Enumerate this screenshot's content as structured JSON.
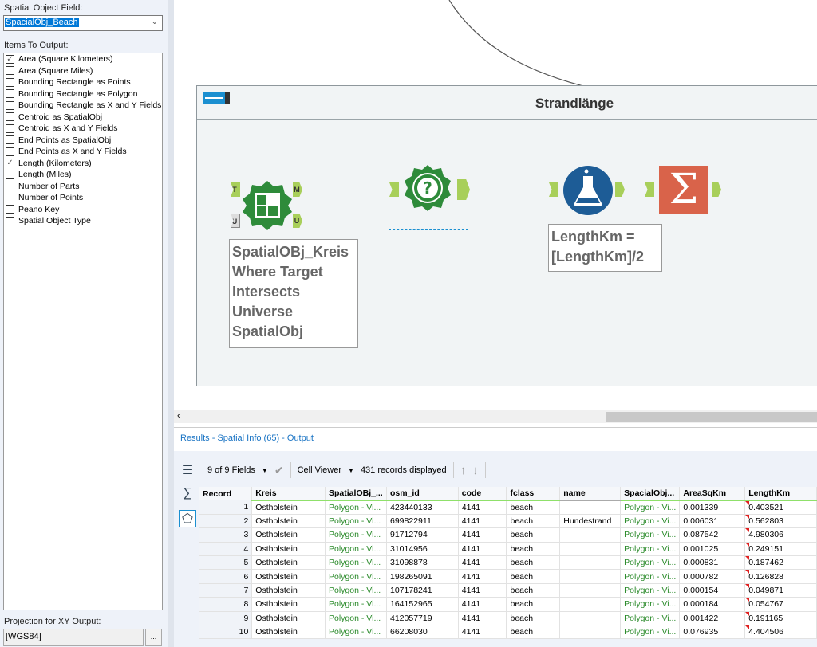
{
  "config": {
    "spatial_field_label": "Spatial Object Field:",
    "spatial_field_value": "SpacialObj_Beach",
    "items_label": "Items To Output:",
    "items": [
      {
        "label": "Area (Square Kilometers)",
        "checked": true
      },
      {
        "label": "Area (Square Miles)",
        "checked": false
      },
      {
        "label": "Bounding Rectangle as Points",
        "checked": false
      },
      {
        "label": "Bounding Rectangle as Polygon",
        "checked": false
      },
      {
        "label": "Bounding Rectangle as X and Y Fields",
        "checked": false
      },
      {
        "label": "Centroid as SpatialObj",
        "checked": false
      },
      {
        "label": "Centroid as X and Y Fields",
        "checked": false
      },
      {
        "label": "End Points as SpatialObj",
        "checked": false
      },
      {
        "label": "End Points as X and Y Fields",
        "checked": false
      },
      {
        "label": "Length (Kilometers)",
        "checked": true
      },
      {
        "label": "Length (Miles)",
        "checked": false
      },
      {
        "label": "Number of Parts",
        "checked": false
      },
      {
        "label": "Number of Points",
        "checked": false
      },
      {
        "label": "Peano Key",
        "checked": false
      },
      {
        "label": "Spatial Object Type",
        "checked": false
      }
    ],
    "projection_label": "Projection for XY Output:",
    "projection_value": "[WGS84]",
    "projection_button": "..."
  },
  "canvas": {
    "container_title": "Strandlänge",
    "spatial_match_annotation": "SpatialOBj_Kreis Where Target Intersects Universe SpatialObj",
    "formula_annotation": "LengthKm = [LengthKm]/2",
    "anchors": {
      "t": "T",
      "u": "U",
      "m": "M",
      "u_out": "U"
    }
  },
  "results": {
    "title": "Results - Spatial Info (65) - Output",
    "fields": "9 of 9 Fields",
    "cell_viewer": "Cell Viewer",
    "records": "431 records displayed",
    "columns": [
      "Record",
      "Kreis",
      "SpatialOBj_...",
      "osm_id",
      "code",
      "fclass",
      "name",
      "SpacialObj...",
      "AreaSqKm",
      "LengthKm"
    ],
    "rows": [
      [
        "1",
        "Ostholstein",
        "Polygon - Vi...",
        "423440133",
        "4141",
        "beach",
        "",
        "Polygon - Vi...",
        "0.001339",
        "0.403521"
      ],
      [
        "2",
        "Ostholstein",
        "Polygon - Vi...",
        "699822911",
        "4141",
        "beach",
        "Hundestrand",
        "Polygon - Vi...",
        "0.006031",
        "0.562803"
      ],
      [
        "3",
        "Ostholstein",
        "Polygon - Vi...",
        "91712794",
        "4141",
        "beach",
        "",
        "Polygon - Vi...",
        "0.087542",
        "4.980306"
      ],
      [
        "4",
        "Ostholstein",
        "Polygon - Vi...",
        "31014956",
        "4141",
        "beach",
        "",
        "Polygon - Vi...",
        "0.001025",
        "0.249151"
      ],
      [
        "5",
        "Ostholstein",
        "Polygon - Vi...",
        "31098878",
        "4141",
        "beach",
        "",
        "Polygon - Vi...",
        "0.000831",
        "0.187462"
      ],
      [
        "6",
        "Ostholstein",
        "Polygon - Vi...",
        "198265091",
        "4141",
        "beach",
        "",
        "Polygon - Vi...",
        "0.000782",
        "0.126828"
      ],
      [
        "7",
        "Ostholstein",
        "Polygon - Vi...",
        "107178241",
        "4141",
        "beach",
        "",
        "Polygon - Vi...",
        "0.000154",
        "0.049871"
      ],
      [
        "8",
        "Ostholstein",
        "Polygon - Vi...",
        "164152965",
        "4141",
        "beach",
        "",
        "Polygon - Vi...",
        "0.000184",
        "0.054767"
      ],
      [
        "9",
        "Ostholstein",
        "Polygon - Vi...",
        "412057719",
        "4141",
        "beach",
        "",
        "Polygon - Vi...",
        "0.001422",
        "0.191165"
      ],
      [
        "10",
        "Ostholstein",
        "Polygon - Vi...",
        "66208030",
        "4141",
        "beach",
        "",
        "Polygon - Vi...",
        "0.076935",
        "4.404506"
      ]
    ]
  },
  "colors": {
    "accent": "#0078d7",
    "spatial_tool": "#2e8b3a",
    "formula_tool": "#1d5c96",
    "summarize_tool": "#d9634a",
    "anchor": "#a8cf5a"
  }
}
